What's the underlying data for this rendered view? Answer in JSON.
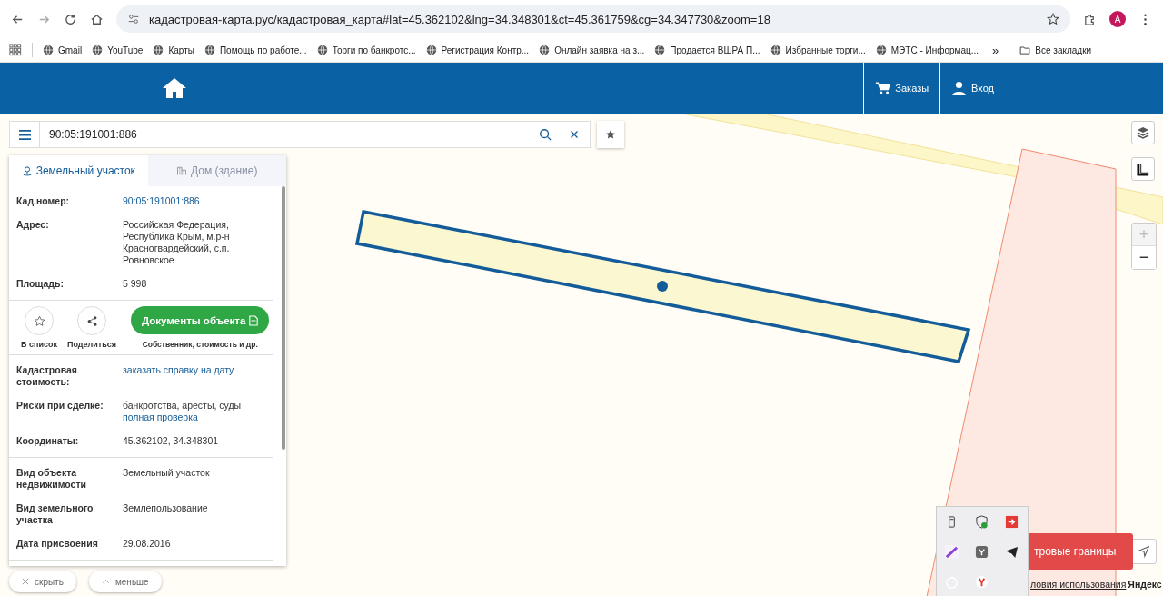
{
  "browser": {
    "url": "кадастровая-карта.рус/кадастровая_карта#lat=45.362102&lng=34.348301&ct=45.361759&cg=34.347730&zoom=18",
    "avatar": "A",
    "bookmarks": [
      "Gmail",
      "YouTube",
      "Карты",
      "Помощь по работе...",
      "Торги по банкротс...",
      "Регистрация Контр...",
      "Онлайн заявка на з...",
      "Продается ВШРА П...",
      "Избранные торги...",
      "МЭТС - Информац..."
    ],
    "more": "»",
    "all_bookmarks": "Все закладки"
  },
  "header": {
    "nav": [
      {
        "kind": "cart",
        "label": "Заказы"
      },
      {
        "kind": "user",
        "label": "Вход"
      }
    ]
  },
  "search": {
    "value": "90:05:191001:886"
  },
  "panel": {
    "tabs": [
      {
        "kind": "land",
        "label": "Земельный участок",
        "selected": true
      },
      {
        "kind": "house",
        "label": "Дом (здание)",
        "selected": false
      }
    ],
    "sections": [
      {
        "kind": "rows",
        "rows": [
          {
            "label": "Кад.номер:",
            "values": [
              {
                "kind": "link",
                "text": "90:05:191001:886"
              }
            ]
          },
          {
            "label": "Адрес:",
            "values": [
              {
                "kind": "text",
                "text": "Российская Федерация, Республика Крым, м.р-н Красногвардейский, с.п. Ровновское"
              }
            ]
          },
          {
            "label": "Площадь:",
            "values": [
              {
                "kind": "text",
                "text": "5 998"
              }
            ]
          }
        ]
      },
      {
        "kind": "actions",
        "actions": [
          {
            "kind": "star",
            "label": "В список"
          },
          {
            "kind": "share",
            "label": "Поделиться"
          }
        ],
        "docs_button": "Документы объекта",
        "docs_note": "Собственник, стоимость и др."
      },
      {
        "kind": "rows",
        "rows": [
          {
            "label": "Кадастровая стоимость:",
            "values": [
              {
                "kind": "link",
                "text": "заказать справку на дату"
              }
            ]
          },
          {
            "label": "Риски при сделке:",
            "values": [
              {
                "kind": "text",
                "text": "банкротства, аресты, суды"
              },
              {
                "kind": "link",
                "text": "полная проверка"
              }
            ]
          },
          {
            "label": "Координаты:",
            "values": [
              {
                "kind": "text",
                "text": "45.362102, 34.348301"
              }
            ]
          }
        ]
      },
      {
        "kind": "rows",
        "rows": [
          {
            "label": "Вид объекта недвижимости",
            "values": [
              {
                "kind": "text",
                "text": "Земельный участок"
              }
            ]
          },
          {
            "label": "Вид земельного участка",
            "values": [
              {
                "kind": "text",
                "text": "Землепользование"
              }
            ]
          },
          {
            "label": "Дата присвоения",
            "values": [
              {
                "kind": "text",
                "text": "29.08.2016"
              }
            ]
          }
        ]
      }
    ]
  },
  "panel_buttons": [
    {
      "kind": "close",
      "label": "скрыть"
    },
    {
      "kind": "collapse",
      "label": "меньше"
    }
  ],
  "map_controls": {
    "zoom_in": {
      "label": "+",
      "disabled": true
    },
    "zoom_out": {
      "label": "−",
      "disabled": false
    }
  },
  "borders_button": "тровые границы",
  "attribution": {
    "terms": "ловия использования",
    "brand": "Яндекс"
  }
}
